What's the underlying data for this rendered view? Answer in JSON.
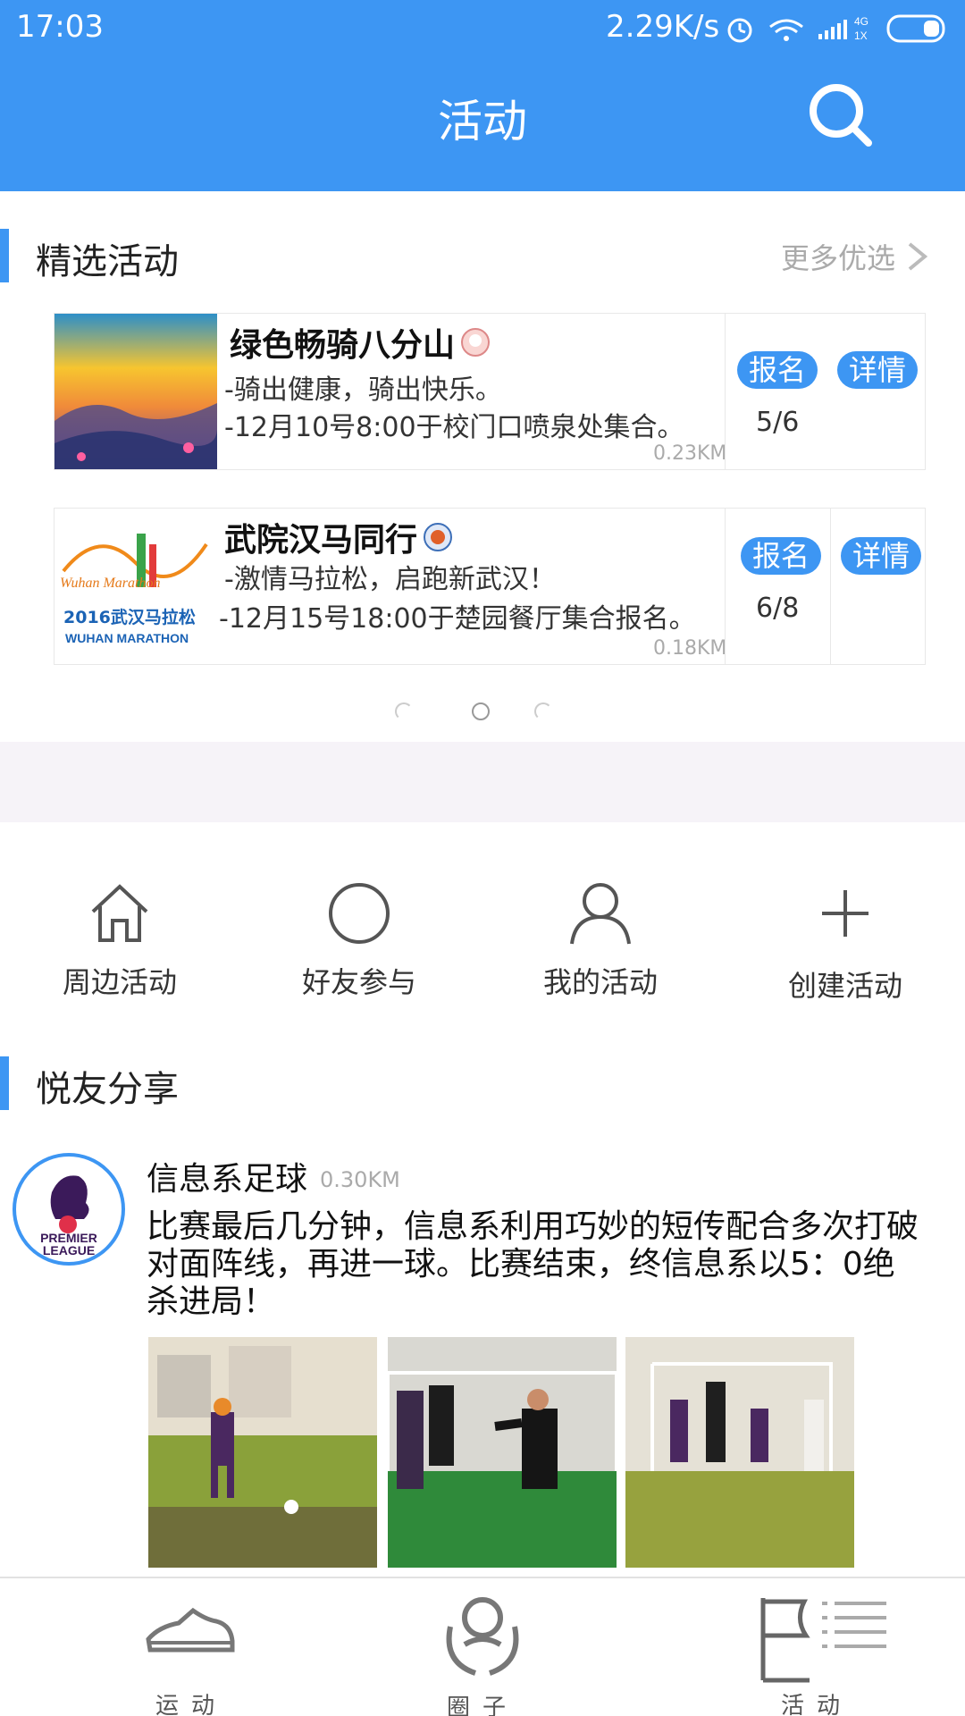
{
  "status": {
    "time": "17:03",
    "speed": "2.29K/s",
    "net_top": "4G",
    "net_bottom": "1X"
  },
  "header": {
    "title": "活动"
  },
  "featured": {
    "title": "精选活动",
    "more_label": "更多优选",
    "cards": [
      {
        "name": "绿色畅骑八分山",
        "line1": "-骑出健康，骑出快乐。",
        "line2": "-12月10号8:00于校门口喷泉处集合。",
        "distance": "0.23KM",
        "signup_label": "报名",
        "detail_label": "详情",
        "count": "5/6"
      },
      {
        "name": "武院汉马同行",
        "line1": "-激情马拉松，启跑新武汉！",
        "line2": "-12月15号18:00于楚园餐厅集合报名。",
        "distance": "0.18KM",
        "signup_label": "报名",
        "detail_label": "详情",
        "count": "6/8",
        "logo_line1": "Wuhan Marathon",
        "logo_line2": "2016武汉马拉松",
        "logo_line3": "WUHAN MARATHON"
      }
    ]
  },
  "quick_actions": [
    {
      "label": "周边活动",
      "icon": "home-icon"
    },
    {
      "label": "好友参与",
      "icon": "circle-icon"
    },
    {
      "label": "我的活动",
      "icon": "person-icon"
    },
    {
      "label": "创建活动",
      "icon": "plus-icon"
    }
  ],
  "share": {
    "title": "悦友分享",
    "post": {
      "author": "信息系足球",
      "distance": "0.30KM",
      "text": "比赛最后几分钟，信息系利用巧妙的短传配合多次打破对面阵线，再进一球。比赛结束，终信息系以5：0绝杀进局！",
      "avatar_text_1": "PREMIER",
      "avatar_text_2": "LEAGUE"
    }
  },
  "tabs": [
    {
      "label": "运动",
      "icon": "shoe-icon"
    },
    {
      "label": "圈子",
      "icon": "circle-people-icon"
    },
    {
      "label": "活动",
      "icon": "flag-icon"
    }
  ],
  "colors": {
    "accent": "#3d96f3",
    "band": "#f6f3f8"
  }
}
